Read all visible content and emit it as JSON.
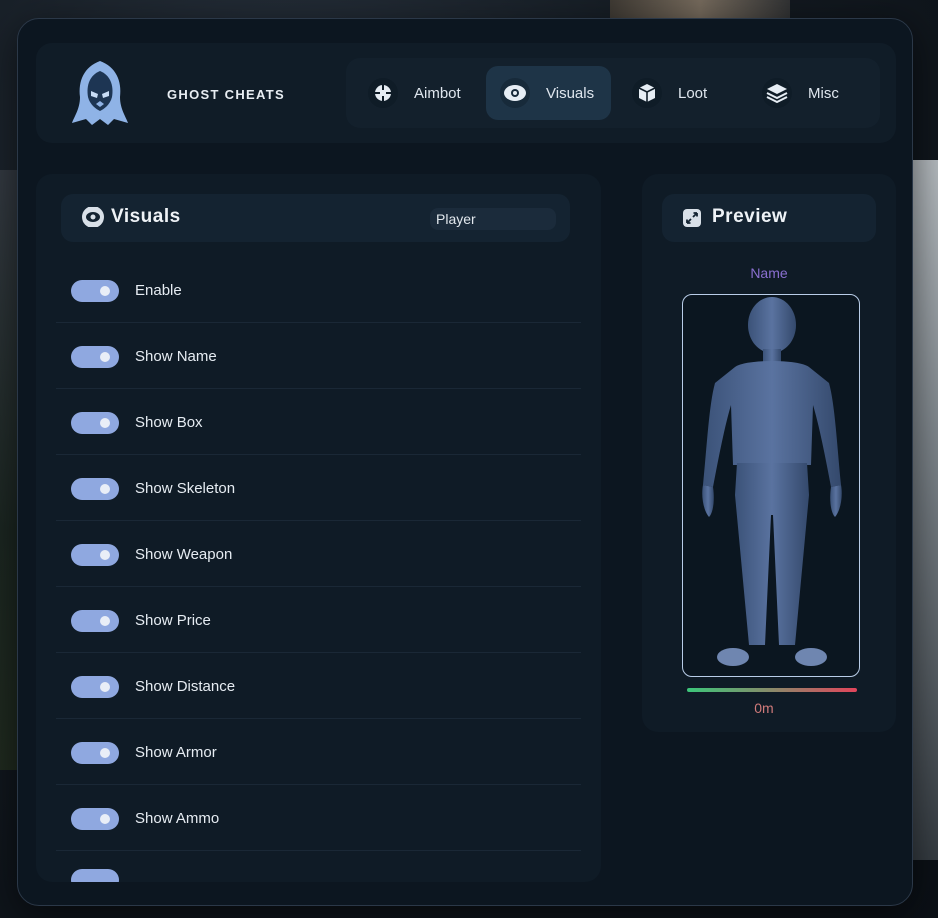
{
  "brand": {
    "name": "GHOST CHEATS",
    "logo_icon": "ghost-hood-icon"
  },
  "tabs": [
    {
      "label": "Aimbot",
      "icon": "crosshair-icon",
      "active": false
    },
    {
      "label": "Visuals",
      "icon": "eye-icon",
      "active": true
    },
    {
      "label": "Loot",
      "icon": "box-icon",
      "active": false
    },
    {
      "label": "Misc",
      "icon": "layers-icon",
      "active": false
    }
  ],
  "visuals_panel": {
    "title": "Visuals",
    "icon": "eye-icon",
    "target_select": "Player",
    "options": [
      {
        "label": "Enable",
        "enabled": true
      },
      {
        "label": "Show Name",
        "enabled": true
      },
      {
        "label": "Show Box",
        "enabled": true
      },
      {
        "label": "Show Skeleton",
        "enabled": true
      },
      {
        "label": "Show Weapon",
        "enabled": true
      },
      {
        "label": "Show Price",
        "enabled": true
      },
      {
        "label": "Show Distance",
        "enabled": true
      },
      {
        "label": "Show Armor",
        "enabled": true
      },
      {
        "label": "Show Ammo",
        "enabled": true
      }
    ]
  },
  "preview_panel": {
    "title": "Preview",
    "icon": "expand-icon",
    "name_label": "Name",
    "distance_label": "0m"
  },
  "colors": {
    "accent_toggle": "#8fa8e0",
    "name_color": "#8a6fd0",
    "distance_color": "#d07a7a",
    "bar_start": "#3cc67a",
    "bar_end": "#e2455b"
  }
}
